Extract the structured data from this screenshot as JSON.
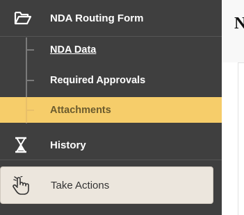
{
  "sidebar": {
    "form": {
      "label": "NDA Routing Form",
      "icon": "folder-open-icon"
    },
    "sub_items": [
      {
        "label": "NDA Data"
      },
      {
        "label": "Required Approvals"
      },
      {
        "label": "Attachments",
        "active": true
      }
    ],
    "history": {
      "label": "History",
      "icon": "hourglass-icon"
    },
    "actions": {
      "label": "Take Actions",
      "icon": "pointer-hand-icon"
    }
  },
  "main": {
    "title_fragment": "N"
  },
  "colors": {
    "sidebar_bg": "#3f3f3f",
    "active_bg": "#f6cd6a",
    "actions_bg": "#ece6dd"
  }
}
